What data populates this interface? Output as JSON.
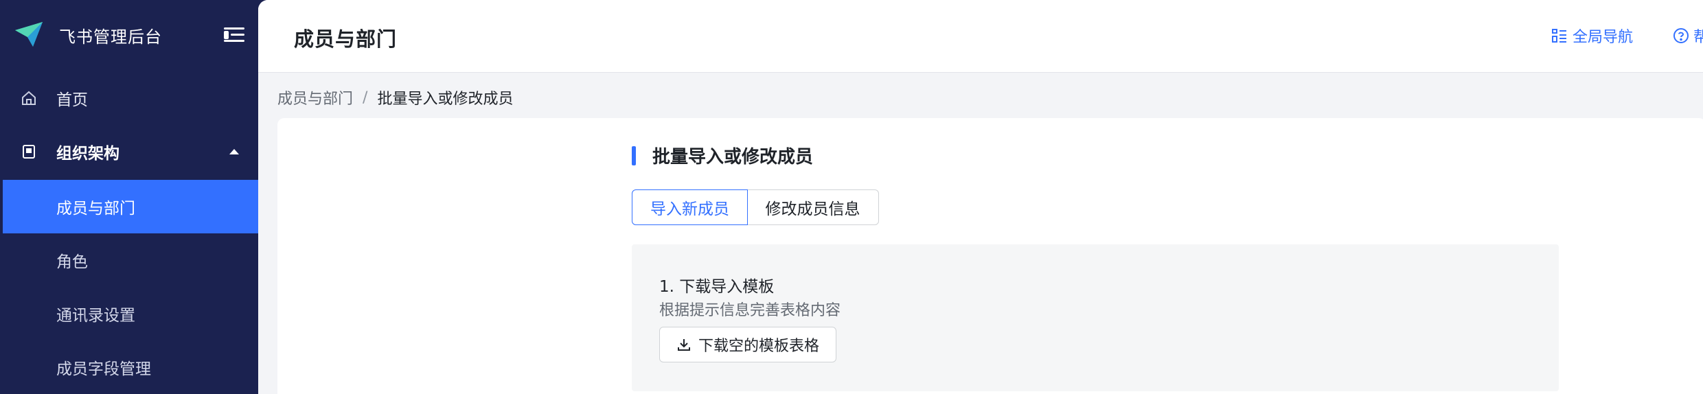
{
  "app": {
    "title": "飞书管理后台",
    "accent_color": "#3370ff",
    "sidebar_color": "#1b2250"
  },
  "sidebar": {
    "collapse_icon": "menu-fold-icon",
    "items": [
      {
        "label": "首页",
        "icon": "home-icon"
      },
      {
        "label": "组织架构",
        "icon": "org-chart-icon",
        "expanded": true
      },
      {
        "label": "成员与部门",
        "active": true
      },
      {
        "label": "角色"
      },
      {
        "label": "通讯录设置"
      },
      {
        "label": "成员字段管理"
      }
    ]
  },
  "header": {
    "title": "成员与部门",
    "global_nav_label": "全局导航",
    "help_label": "帮"
  },
  "breadcrumb": {
    "parent": "成员与部门",
    "separator": "/",
    "current": "批量导入或修改成员"
  },
  "content": {
    "section_title": "批量导入或修改成员",
    "tabs": [
      {
        "label": "导入新成员",
        "selected": true
      },
      {
        "label": "修改成员信息",
        "selected": false
      }
    ],
    "step1": {
      "title": "1. 下载导入模板",
      "description": "根据提示信息完善表格内容",
      "button_label": "下载空的模板表格"
    }
  }
}
